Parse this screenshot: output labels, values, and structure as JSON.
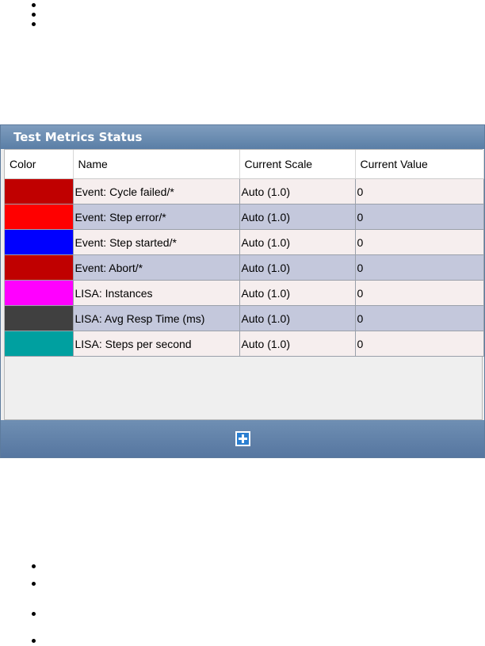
{
  "panel": {
    "title": "Test Metrics Status",
    "columns": [
      "Color",
      "Name",
      "Current Scale",
      "Current Value"
    ],
    "rows": [
      {
        "color": "#c00000",
        "name": "Event: Cycle failed/*",
        "scale": "Auto (1.0)",
        "value": "0"
      },
      {
        "color": "#ff0000",
        "name": "Event: Step error/*",
        "scale": "Auto (1.0)",
        "value": "0"
      },
      {
        "color": "#0000ff",
        "name": "Event: Step started/*",
        "scale": "Auto (1.0)",
        "value": "0"
      },
      {
        "color": "#c00000",
        "name": "Event: Abort/*",
        "scale": "Auto (1.0)",
        "value": "0"
      },
      {
        "color": "#ff00ff",
        "name": "LISA: Instances",
        "scale": "Auto (1.0)",
        "value": "0"
      },
      {
        "color": "#404040",
        "name": "LISA: Avg Resp Time (ms)",
        "scale": "Auto (1.0)",
        "value": "0"
      },
      {
        "color": "#00a0a0",
        "name": "LISA: Steps per second",
        "scale": "Auto (1.0)",
        "value": "0"
      }
    ],
    "add_icon": "plus-icon"
  }
}
